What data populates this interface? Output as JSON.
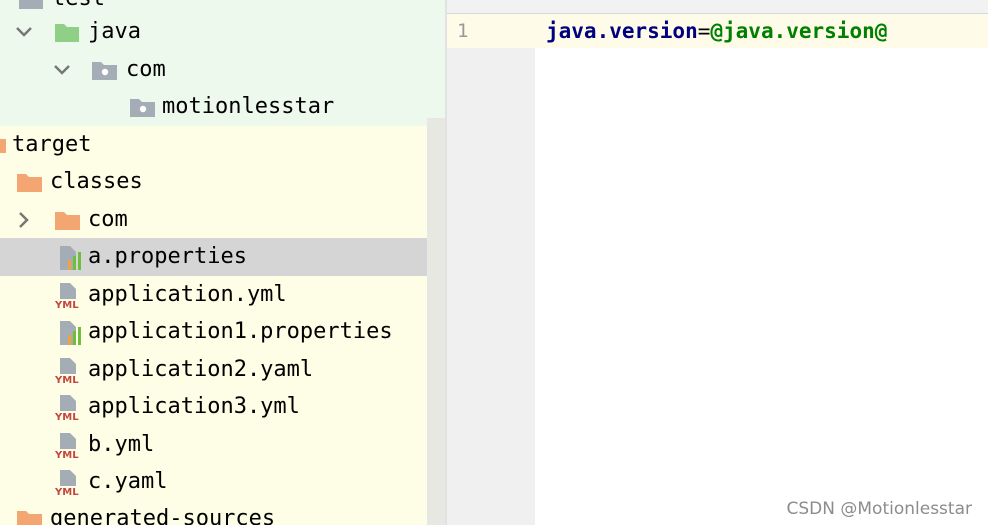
{
  "tree": {
    "items": [
      {
        "label": "test",
        "icon": "folder-icon"
      },
      {
        "label": "java",
        "icon": "source-folder-icon"
      },
      {
        "label": "com",
        "icon": "package-icon"
      },
      {
        "label": "motionlesstar",
        "icon": "package-icon"
      },
      {
        "label": "target",
        "icon": "folder-excluded-icon"
      },
      {
        "label": "classes",
        "icon": "folder-excluded-icon"
      },
      {
        "label": "com",
        "icon": "folder-excluded-icon"
      },
      {
        "label": "a.properties",
        "icon": "properties-file-icon",
        "selected": true
      },
      {
        "label": "application.yml",
        "icon": "yml-file-icon"
      },
      {
        "label": "application1.properties",
        "icon": "properties-file-icon"
      },
      {
        "label": "application2.yaml",
        "icon": "yml-file-icon"
      },
      {
        "label": "application3.yml",
        "icon": "yml-file-icon"
      },
      {
        "label": "b.yml",
        "icon": "yml-file-icon"
      },
      {
        "label": "c.yaml",
        "icon": "yml-file-icon"
      },
      {
        "label": "generated-sources",
        "icon": "folder-excluded-icon"
      }
    ]
  },
  "editor": {
    "line_number": "1",
    "code_key": "java.version",
    "code_eq": "=",
    "code_value": "@java.version@"
  },
  "colors": {
    "test_bg": "#eef9ee",
    "target_bg": "#fefee6",
    "selected_bg": "#d5d5d5",
    "excluded_folder": "#f4a672",
    "source_folder": "#8fcf86",
    "package_folder": "#a4adb5",
    "key": "#000080",
    "value": "#008000"
  },
  "watermark": "CSDN @Motionlesstar"
}
